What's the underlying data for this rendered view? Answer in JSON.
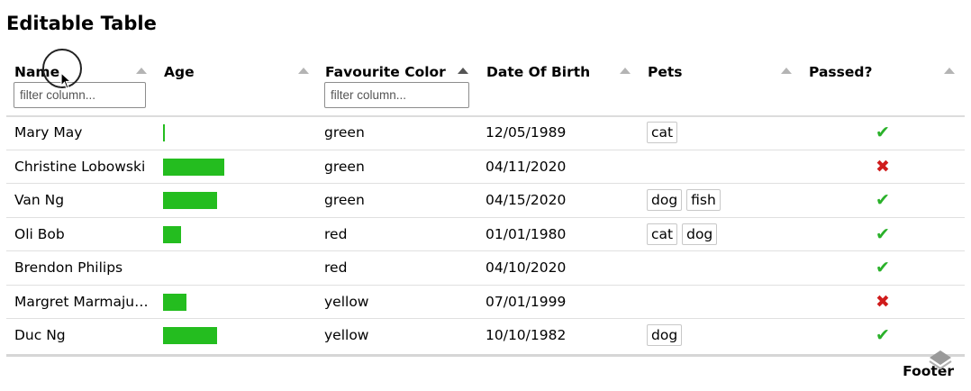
{
  "title": "Editable Table",
  "columns": [
    {
      "label": "Name",
      "filter_placeholder": "filter column...",
      "sort_active": false
    },
    {
      "label": "Age",
      "sort_active": false
    },
    {
      "label": "Favourite Color",
      "filter_placeholder": "filter column...",
      "sort_active": true
    },
    {
      "label": "Date Of Birth",
      "sort_active": false
    },
    {
      "label": "Pets",
      "sort_active": false
    },
    {
      "label": "Passed?",
      "sort_active": false
    }
  ],
  "rows": [
    {
      "name": "Mary May",
      "age_fraction": 0.01,
      "color": "green",
      "dob": "12/05/1989",
      "pets": [
        "cat"
      ],
      "passed": true
    },
    {
      "name": "Christine Lobowski",
      "age_fraction": 0.45,
      "color": "green",
      "dob": "04/11/2020",
      "pets": [],
      "passed": false
    },
    {
      "name": "Van Ng",
      "age_fraction": 0.4,
      "color": "green",
      "dob": "04/15/2020",
      "pets": [
        "dog",
        "fish"
      ],
      "passed": true
    },
    {
      "name": "Oli Bob",
      "age_fraction": 0.13,
      "color": "red",
      "dob": "01/01/1980",
      "pets": [
        "cat",
        "dog"
      ],
      "passed": true
    },
    {
      "name": "Brendon Philips",
      "age_fraction": 0,
      "color": "red",
      "dob": "04/10/2020",
      "pets": [],
      "passed": true
    },
    {
      "name": "Margret Marmajuke",
      "age_fraction": 0.17,
      "color": "yellow",
      "dob": "07/01/1999",
      "pets": [],
      "passed": false
    },
    {
      "name": "Duc Ng",
      "age_fraction": 0.4,
      "color": "yellow",
      "dob": "10/10/1982",
      "pets": [
        "dog"
      ],
      "passed": true
    }
  ],
  "footer": "Footer",
  "colors": {
    "age_bar": "#24bd1f",
    "pass": "#2ab12a",
    "fail": "#d01c1c"
  },
  "icons": {
    "pass": "check-icon",
    "fail": "cross-icon",
    "sort": "sort-arrow-icon"
  }
}
